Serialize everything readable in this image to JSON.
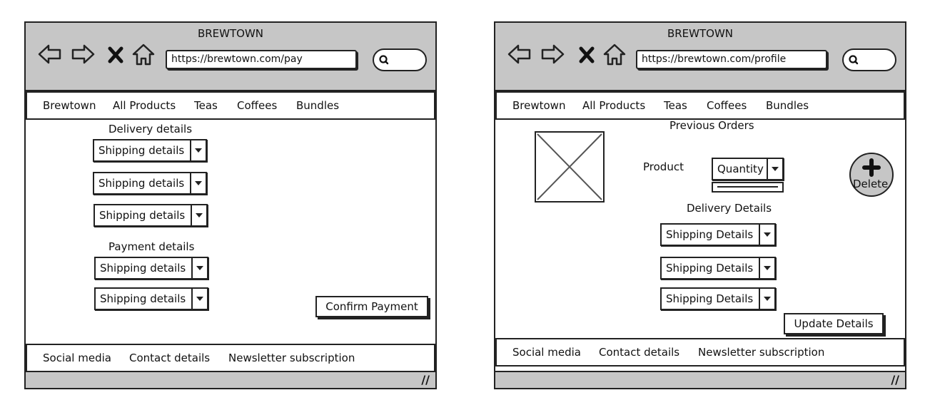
{
  "left": {
    "title": "BREWTOWN",
    "url": "https://brewtown.com/pay",
    "nav": [
      "Brewtown",
      "All Products",
      "Teas",
      "Coffees",
      "Bundles"
    ],
    "delivery_heading": "Delivery details",
    "delivery_fields": [
      "Shipping details",
      "Shipping details",
      "Shipping details"
    ],
    "payment_heading": "Payment details",
    "payment_fields": [
      "Shipping details",
      "Shipping details"
    ],
    "confirm_button": "Confirm Payment",
    "footer": [
      "Social media",
      "Contact details",
      "Newsletter subscription"
    ]
  },
  "right": {
    "title": "BREWTOWN",
    "url": "https://brewtown.com/profile",
    "nav": [
      "Brewtown",
      "All Products",
      "Teas",
      "Coffees",
      "Bundles"
    ],
    "orders_heading": "Previous Orders",
    "product_label": "Product",
    "quantity_select": "Quantity",
    "delete_label": "Delete",
    "delivery_heading": "Delivery Details",
    "delivery_fields": [
      "Shipping Details",
      "Shipping Details",
      "Shipping Details"
    ],
    "update_button": "Update Details",
    "footer": [
      "Social media",
      "Contact details",
      "Newsletter subscription"
    ]
  }
}
